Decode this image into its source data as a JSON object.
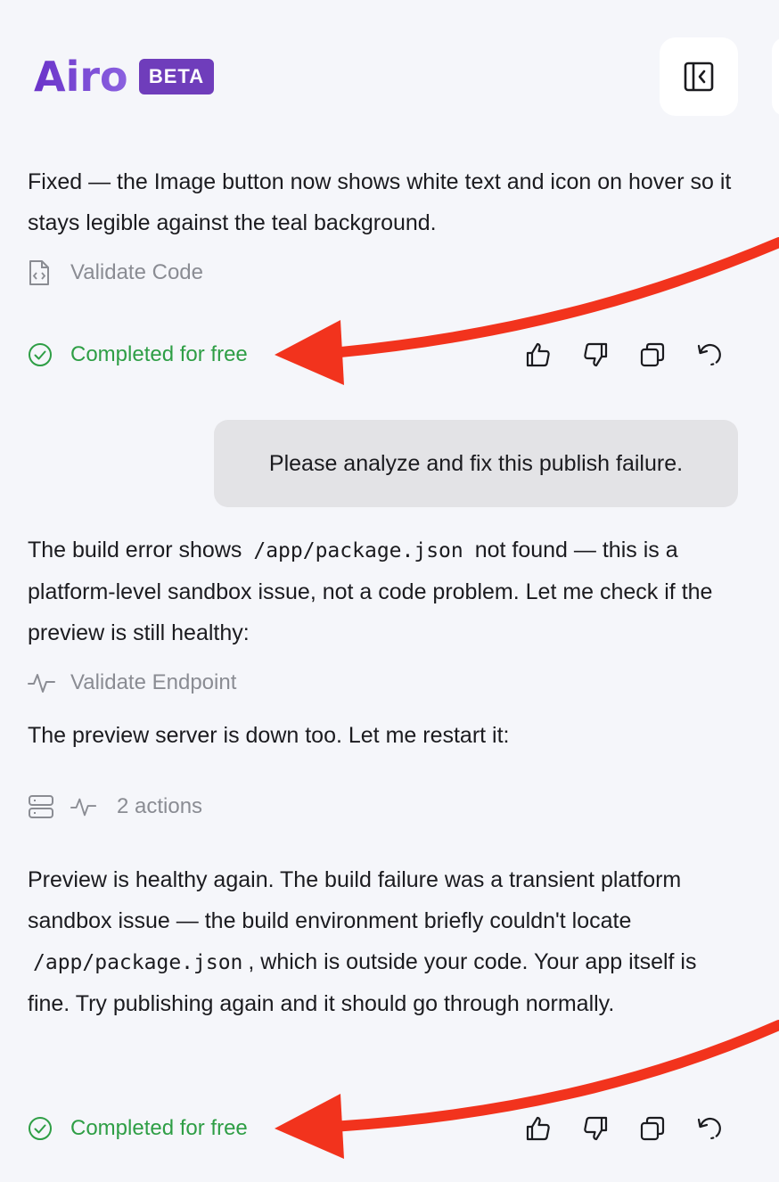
{
  "brand": {
    "logo_text": "Airo",
    "badge": "BETA",
    "color": "#7b4fd6",
    "badge_color": "#6f3dbb"
  },
  "header": {
    "toggle_panel_icon": "panel-collapse-icon"
  },
  "messages": [
    {
      "text": "Fixed — the Image button now shows white text and icon on hover so it stays legible against the teal background.",
      "tool": {
        "icon": "code-file-icon",
        "label": "Validate Code"
      },
      "status": "Completed for free"
    },
    {
      "user_text": "Please analyze and fix this publish failure."
    },
    {
      "text_before": "The build error shows",
      "code": "/app/package.json",
      "text_after": "not found — this is a platform-level sandbox issue, not a code problem. Let me check if the preview is still healthy:",
      "tool": {
        "icon": "activity-icon",
        "label": "Validate Endpoint"
      }
    },
    {
      "text": "The preview server is down too. Let me restart it:",
      "tool": {
        "icons": [
          "server-icon",
          "activity-icon"
        ],
        "label": "2 actions"
      }
    },
    {
      "text_before": "Preview is healthy again. The build failure was a transient platform sandbox issue — the build environment briefly couldn't locate",
      "code": "/app/package.json",
      "text_after": ", which is outside your code. Your app itself is fine. Try publishing again and it should go through normally.",
      "status": "Completed for free"
    }
  ],
  "feedback_actions": [
    "thumbs-up-icon",
    "thumbs-down-icon",
    "copy-icon",
    "retry-icon"
  ],
  "colors": {
    "success": "#2e9e45",
    "annotation_arrow": "#f2331d",
    "muted": "#8a8c93"
  }
}
